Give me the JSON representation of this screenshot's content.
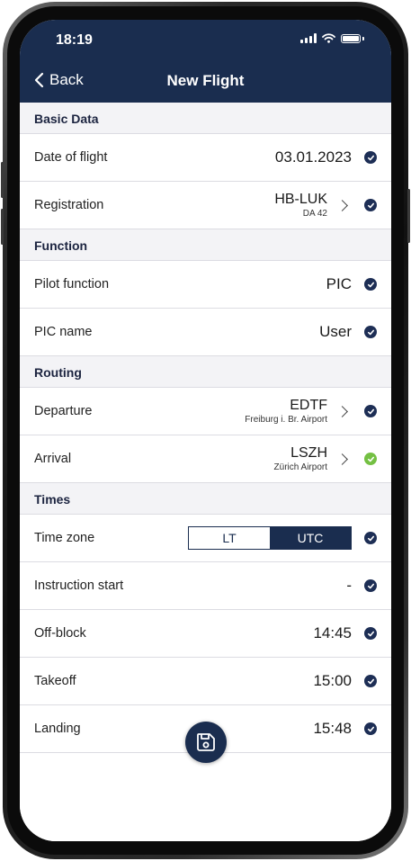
{
  "status_bar": {
    "time": "18:19"
  },
  "nav": {
    "back_label": "Back",
    "title": "New Flight"
  },
  "sections": {
    "basic": "Basic Data",
    "function": "Function",
    "routing": "Routing",
    "times": "Times"
  },
  "rows": {
    "date": {
      "label": "Date of flight",
      "value": "03.01.2023"
    },
    "registration": {
      "label": "Registration",
      "value": "HB-LUK",
      "sub": "DA 42"
    },
    "pilot_function": {
      "label": "Pilot function",
      "value": "PIC"
    },
    "pic_name": {
      "label": "PIC name",
      "value": "User"
    },
    "departure": {
      "label": "Departure",
      "value": "EDTF",
      "sub": "Freiburg i. Br. Airport"
    },
    "arrival": {
      "label": "Arrival",
      "value": "LSZH",
      "sub": "Zürich Airport"
    },
    "time_zone": {
      "label": "Time zone",
      "options": [
        "LT",
        "UTC"
      ],
      "selected": "UTC"
    },
    "instruction_start": {
      "label": "Instruction start",
      "value": "-"
    },
    "off_block": {
      "label": "Off-block",
      "value": "14:45"
    },
    "takeoff": {
      "label": "Takeoff",
      "value": "15:00"
    },
    "landing": {
      "label": "Landing",
      "value": "15:48"
    }
  },
  "icons": {
    "check": "check-circle-icon",
    "check_valid": "check-circle-green-icon",
    "save": "save-icon",
    "chevron": "chevron-right-icon",
    "back": "chevron-left-icon"
  },
  "colors": {
    "primary": "#1a2d4f",
    "valid": "#74c043",
    "section_bg": "#f3f3f6"
  }
}
